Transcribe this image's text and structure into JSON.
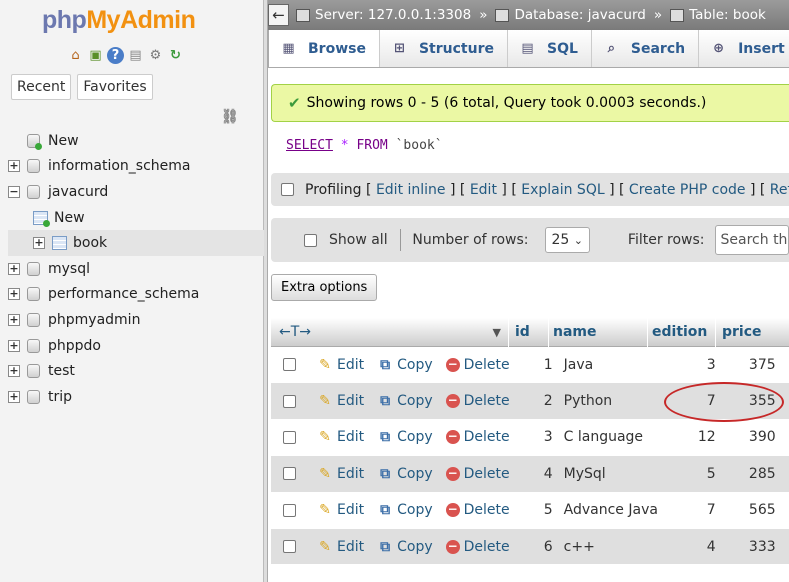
{
  "nav": {
    "logo": {
      "php": "php",
      "my": "My",
      "admin": "Admin"
    },
    "icons": [
      "home-icon",
      "exit-icon",
      "help-icon",
      "docs-icon",
      "settings-icon",
      "reload-icon"
    ],
    "tabs": [
      "Recent",
      "Favorites"
    ],
    "tree": [
      {
        "label": "New",
        "type": "new",
        "level": 0
      },
      {
        "label": "information_schema",
        "type": "db",
        "level": 0
      },
      {
        "label": "javacurd",
        "type": "db",
        "level": 0,
        "expanded": true
      },
      {
        "label": "New",
        "type": "new",
        "level": 1
      },
      {
        "label": "book",
        "type": "table",
        "level": 1,
        "selected": true
      },
      {
        "label": "mysql",
        "type": "db",
        "level": 0
      },
      {
        "label": "performance_schema",
        "type": "db",
        "level": 0
      },
      {
        "label": "phpmyadmin",
        "type": "db",
        "level": 0
      },
      {
        "label": "phppdo",
        "type": "db",
        "level": 0
      },
      {
        "label": "test",
        "type": "db",
        "level": 0
      },
      {
        "label": "trip",
        "type": "db",
        "level": 0
      }
    ]
  },
  "breadcrumb": {
    "server": "Server: 127.0.0.1:3308",
    "database": "Database: javacurd",
    "table": "Table: book",
    "separator": "»"
  },
  "menu": [
    "Browse",
    "Structure",
    "SQL",
    "Search",
    "Insert"
  ],
  "success_message": "Showing rows 0 - 5 (6 total, Query took 0.0003 seconds.)",
  "sql": {
    "select": "SELECT",
    "star": "*",
    "from": "FROM",
    "table": "`book`"
  },
  "profiling": {
    "label": "Profiling",
    "links": [
      "Edit inline",
      "Edit",
      "Explain SQL",
      "Create PHP code",
      "Refresh"
    ]
  },
  "navigation": {
    "show_all": "Show all",
    "rows_label": "Number of rows:",
    "rows_value": "25",
    "filter_label": "Filter rows:",
    "search_placeholder": "Search this t"
  },
  "extra_options": "Extra options",
  "table": {
    "columns": [
      "id",
      "name",
      "edition",
      "price"
    ],
    "actions": {
      "edit": "Edit",
      "copy": "Copy",
      "delete": "Delete"
    },
    "rows": [
      {
        "id": "1",
        "name": "Java",
        "edition": "3",
        "price": "375"
      },
      {
        "id": "2",
        "name": "Python",
        "edition": "7",
        "price": "355"
      },
      {
        "id": "3",
        "name": "C language",
        "edition": "12",
        "price": "390"
      },
      {
        "id": "4",
        "name": "MySql",
        "edition": "5",
        "price": "285"
      },
      {
        "id": "5",
        "name": "Advance Java",
        "edition": "7",
        "price": "565"
      },
      {
        "id": "6",
        "name": "c++",
        "edition": "4",
        "price": "333"
      }
    ]
  },
  "colors": {
    "link": "#235a81",
    "success_bg": "#ebf8a4",
    "highlight": "#c62828"
  }
}
